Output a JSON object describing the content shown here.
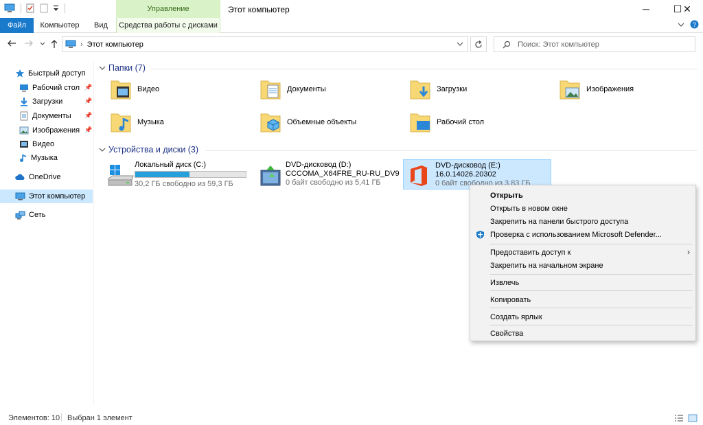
{
  "window": {
    "title": "Этот компьютер",
    "context_tab_group": "Управление",
    "controls": {
      "minimize": "─",
      "maximize": "☐",
      "close": "✕"
    }
  },
  "ribbon": {
    "tabs": [
      "Файл",
      "Компьютер",
      "Вид",
      "Средства работы с дисками"
    ],
    "active_tab_color": "#1979ca",
    "context_color": "#d9f2c7"
  },
  "address": {
    "breadcrumb_sep": "›",
    "location": "Этот компьютер",
    "search_placeholder": "Поиск: Этот компьютер"
  },
  "nav": {
    "quick_access": "Быстрый доступ",
    "quick_items": [
      {
        "label": "Рабочий стол",
        "icon": "desktop-icon"
      },
      {
        "label": "Загрузки",
        "icon": "download-icon"
      },
      {
        "label": "Документы",
        "icon": "document-icon"
      },
      {
        "label": "Изображения",
        "icon": "picture-icon"
      },
      {
        "label": "Видео",
        "icon": "video-icon"
      },
      {
        "label": "Музыка",
        "icon": "music-icon"
      }
    ],
    "onedrive": "OneDrive",
    "this_pc": "Этот компьютер",
    "network": "Сеть"
  },
  "folders": {
    "header": "Папки (7)",
    "items": [
      "Видео",
      "Документы",
      "Загрузки",
      "Изображения",
      "Музыка",
      "Объемные объекты",
      "Рабочий стол"
    ]
  },
  "devices": {
    "header": "Устройства и диски (3)",
    "drives": [
      {
        "name": "Локальный диск (C:)",
        "detail": "30,2 ГБ свободно из 59,3 ГБ",
        "used_fraction": 0.49
      },
      {
        "name": "DVD-дисковод (D:)",
        "label": "CCCOMA_X64FRE_RU-RU_DV9",
        "detail": "0 байт свободно из 5,41 ГБ"
      },
      {
        "name": "DVD-дисковод (E:)",
        "label": "16.0.14026.20302",
        "detail": "0 байт свободно из 3,83 ГБ"
      }
    ]
  },
  "context_menu": {
    "items": [
      "Открыть",
      "Открыть в новом окне",
      "Закрепить на панели быстрого доступа",
      "Проверка с использованием Microsoft Defender...",
      "Предоставить доступ к",
      "Закрепить на начальном экране",
      "Извлечь",
      "Копировать",
      "Создать ярлык",
      "Свойства"
    ],
    "submenu_arrow": "›"
  },
  "status": {
    "count": "Элементов: 10",
    "selected": "Выбран 1 элемент"
  }
}
